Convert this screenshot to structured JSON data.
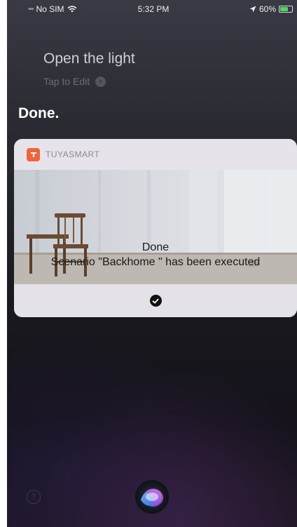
{
  "status_bar": {
    "carrier": "No SIM",
    "time": "5:32 PM",
    "battery": "60%"
  },
  "siri": {
    "query": "Open the light",
    "tap_to_edit": "Tap to Edit",
    "response": "Done."
  },
  "card": {
    "app_name": "TUYASMART",
    "title": "Done",
    "message": "Scenario \"Backhome \" has been executed"
  },
  "colors": {
    "app_icon": "#f0643c",
    "battery": "#4cd964"
  },
  "icons": {
    "wifi": "wifi-icon",
    "location": "location-arrow-icon",
    "battery": "battery-icon",
    "chevron": "chevron-right-icon",
    "check": "checkmark-icon",
    "help": "help-icon",
    "siri": "siri-orb-icon"
  }
}
